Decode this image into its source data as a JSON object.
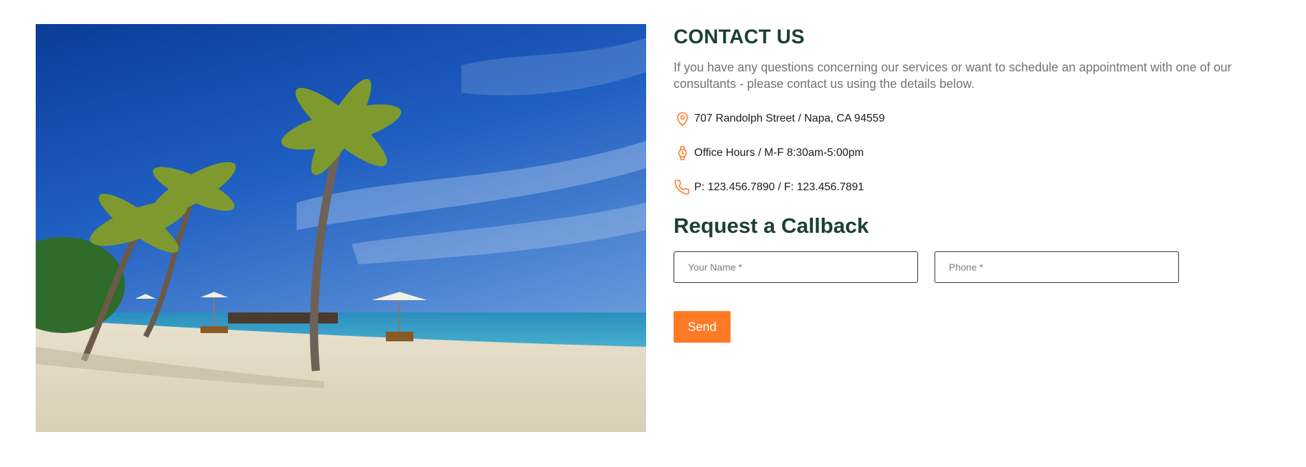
{
  "contact": {
    "title": "CONTACT US",
    "intro": "If you have any questions concerning our services or want to schedule an appointment with one of our consultants - please contact us using the details below.",
    "address": {
      "icon": "location-pin-icon",
      "text": "707 Randolph Street / Napa, CA 94559"
    },
    "hours": {
      "icon": "watch-icon",
      "text": "Office Hours / M-F 8:30am-5:00pm"
    },
    "phone": {
      "icon": "phone-icon",
      "text": "P: 123.456.7890 / F: 123.456.7891"
    }
  },
  "callback": {
    "title": "Request a Callback",
    "name_placeholder": "Your Name *",
    "phone_placeholder": "Phone *",
    "send_label": "Send"
  },
  "colors": {
    "heading": "#1c4036",
    "accent": "#ff7a26",
    "body_text": "#6f7478"
  }
}
